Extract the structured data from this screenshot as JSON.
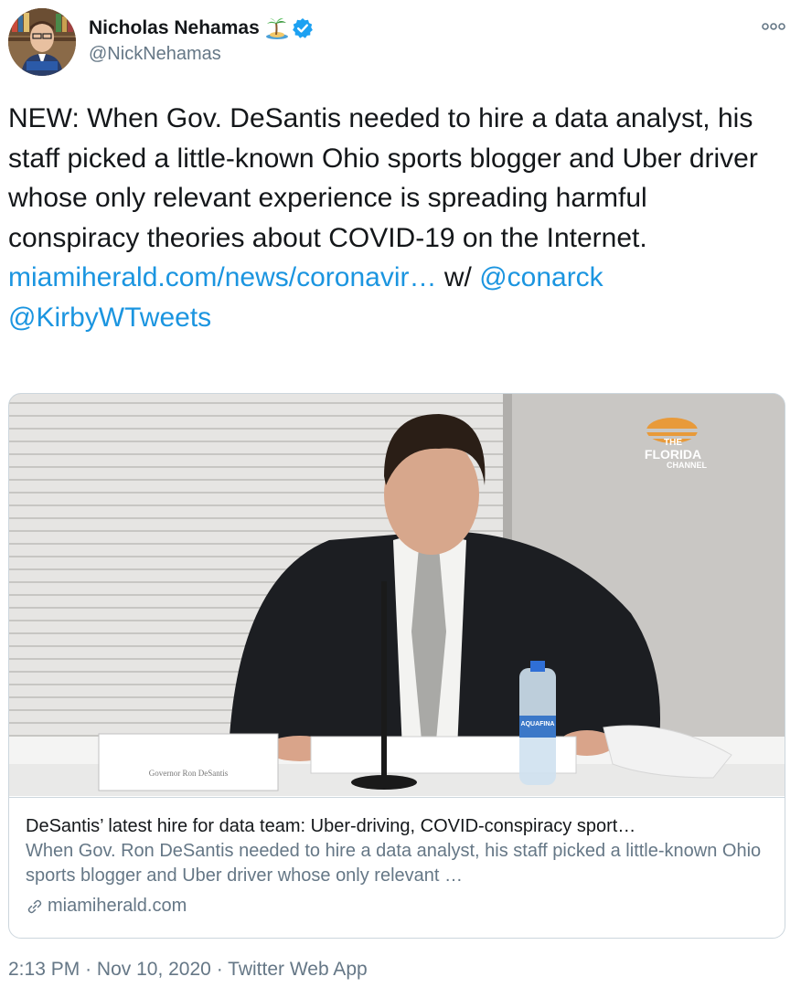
{
  "author": {
    "display_name": "Nicholas Nehamas",
    "emoji": "🏝",
    "handle": "@NickNehamas",
    "verified": true
  },
  "tweet": {
    "text_main": "NEW: When Gov. DeSantis needed to hire a data analyst, his staff picked a little-known Ohio sports blogger and Uber driver whose only relevant experience is spreading harmful conspiracy theories about COVID-19 on the Internet.",
    "link_text": "miamiherald.com/news/coronavir…",
    "with_text": "w/",
    "mention_1": "@conarck",
    "mention_2": "@KirbyWTweets"
  },
  "card": {
    "image_logo_line1": "THE",
    "image_logo_line2": "FLORIDA",
    "image_logo_line3": "CHANNEL",
    "nameplate": "Governor Ron DeSantis",
    "bottle_label": "AQUAFINA",
    "title": "DeSantis’ latest hire for data team: Uber-driving, COVID-conspiracy sport…",
    "description": "When Gov. Ron DeSantis needed to hire a data analyst, his staff picked a little-known Ohio sports blogger and Uber driver whose only relevant …",
    "domain": "miamiherald.com"
  },
  "meta": {
    "time": "2:13 PM",
    "separator": "·",
    "date": "Nov 10, 2020",
    "source": "Twitter Web App"
  },
  "colors": {
    "link": "#1b95e0",
    "secondary_text": "#657786",
    "border": "#ccd6dd",
    "verified": "#1da1f2"
  }
}
